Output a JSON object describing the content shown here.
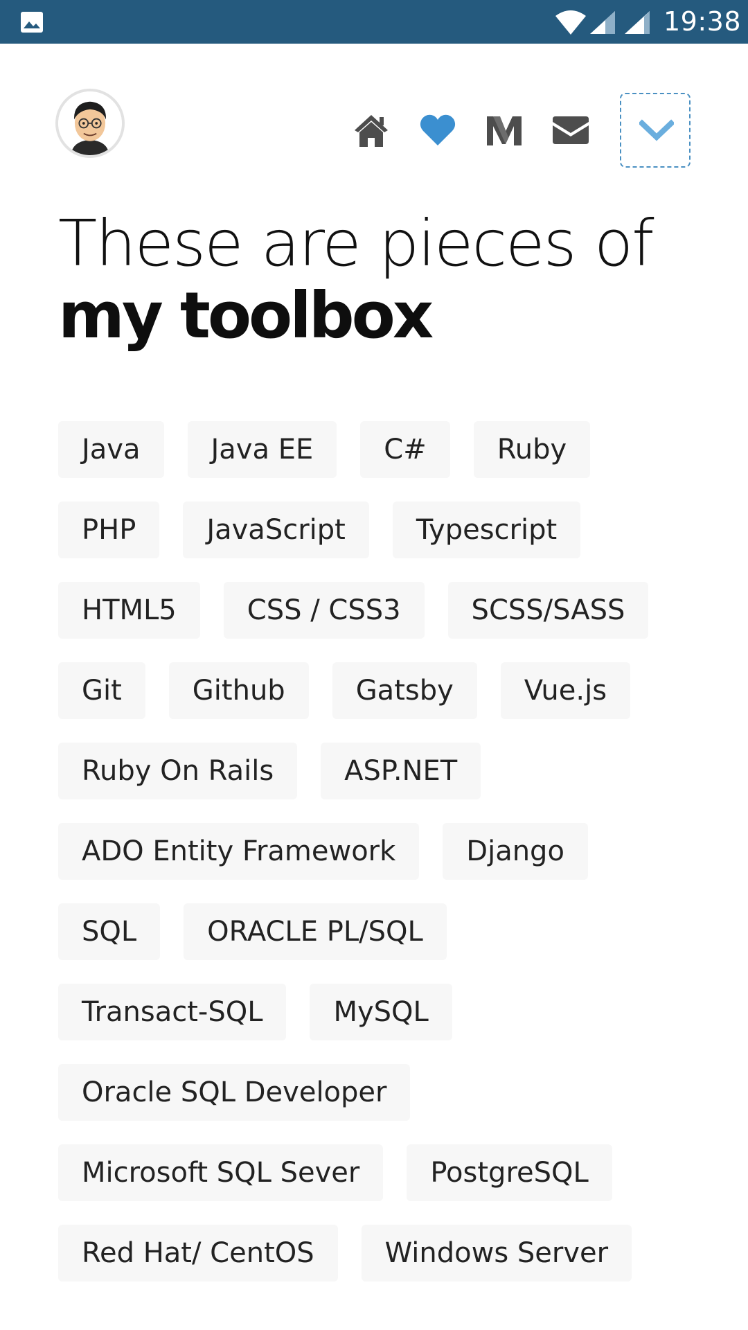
{
  "status_bar": {
    "time": "19:38",
    "icons": [
      "gallery-icon",
      "wifi-icon",
      "signal-icon",
      "signal-icon"
    ],
    "background_color": "#255a7e"
  },
  "header": {
    "avatar": "avatar",
    "nav_icons": [
      "home-icon",
      "heart-icon",
      "medium-icon",
      "mail-icon"
    ],
    "heart_color": "#3b8fd0",
    "icon_color": "#4d4d4d",
    "toggle_icon": "chevron-down-icon",
    "toggle_color": "#6aaede"
  },
  "heading": {
    "line1": "These are pieces of",
    "line2": "my toolbox"
  },
  "tags": [
    "Java",
    "Java EE",
    "C#",
    "Ruby",
    "PHP",
    "JavaScript",
    "Typescript",
    "HTML5",
    "CSS / CSS3",
    "SCSS/SASS",
    "Git",
    "Github",
    "Gatsby",
    "Vue.js",
    "Ruby On Rails",
    "ASP.NET",
    "ADO Entity Framework",
    "Django",
    "SQL",
    "ORACLE PL/SQL",
    "Transact-SQL",
    "MySQL",
    "Oracle SQL Developer",
    "Microsoft SQL Sever",
    "PostgreSQL",
    "Red Hat/ CentOS",
    "Windows Server"
  ]
}
